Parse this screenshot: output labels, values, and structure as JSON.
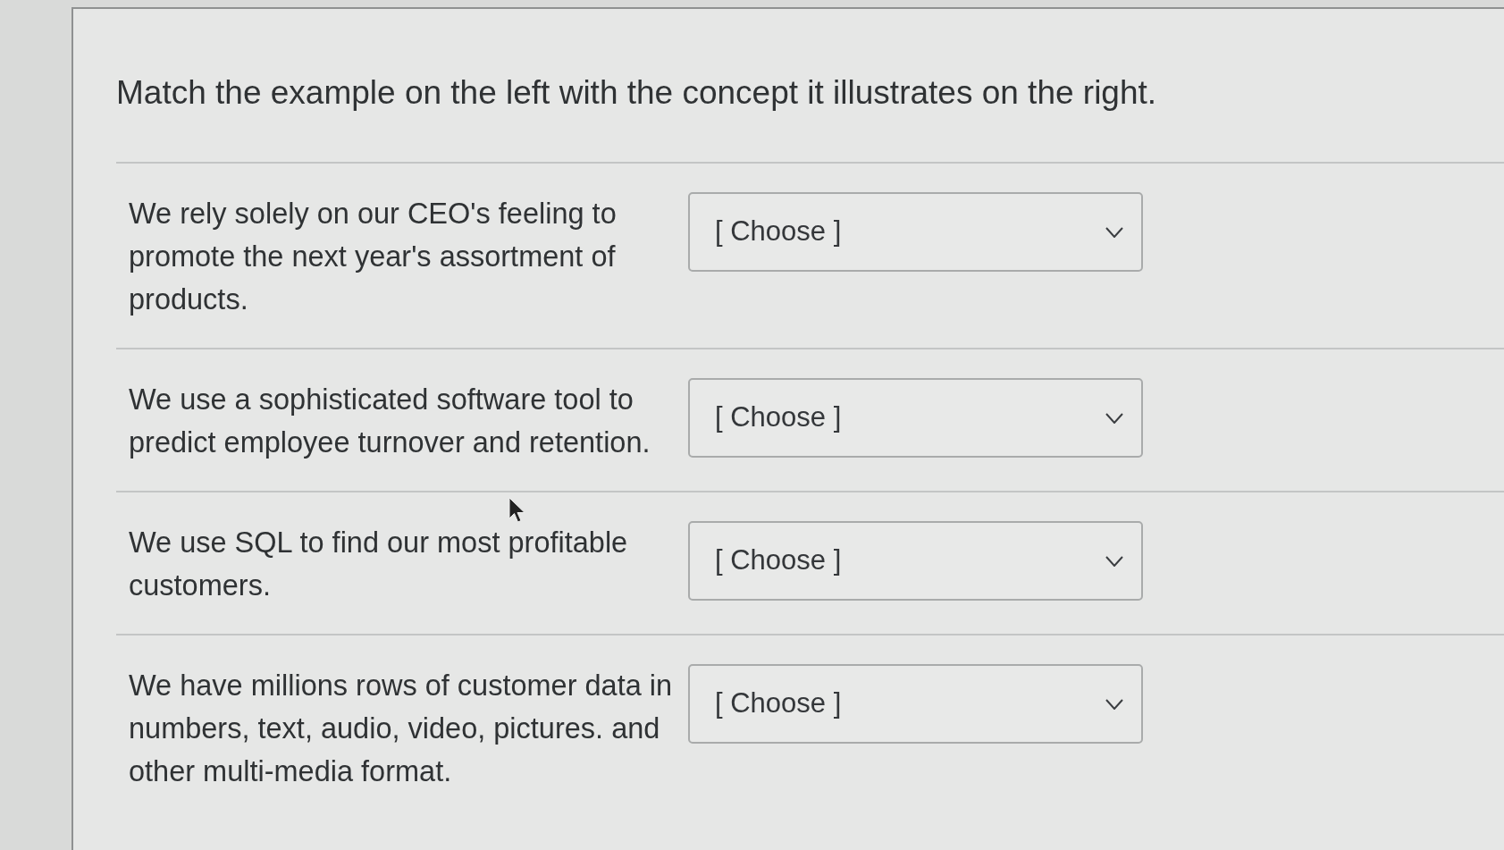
{
  "instruction": "Match the example on the left with the concept it illustrates on the right.",
  "questions": [
    {
      "example": "We rely solely on our CEO's feeling to promote the next year's assortment of products.",
      "dropdown": {
        "value": "[ Choose ]"
      }
    },
    {
      "example": "We use a sophisticated software tool to predict employee turnover and retention.",
      "dropdown": {
        "value": "[ Choose ]"
      }
    },
    {
      "example": "We use SQL to find our most profitable customers.",
      "dropdown": {
        "value": "[ Choose ]"
      }
    },
    {
      "example": "We have millions rows of customer data in numbers, text, audio, video, pictures. and other multi-media format.",
      "dropdown": {
        "value": "[ Choose ]"
      }
    }
  ]
}
